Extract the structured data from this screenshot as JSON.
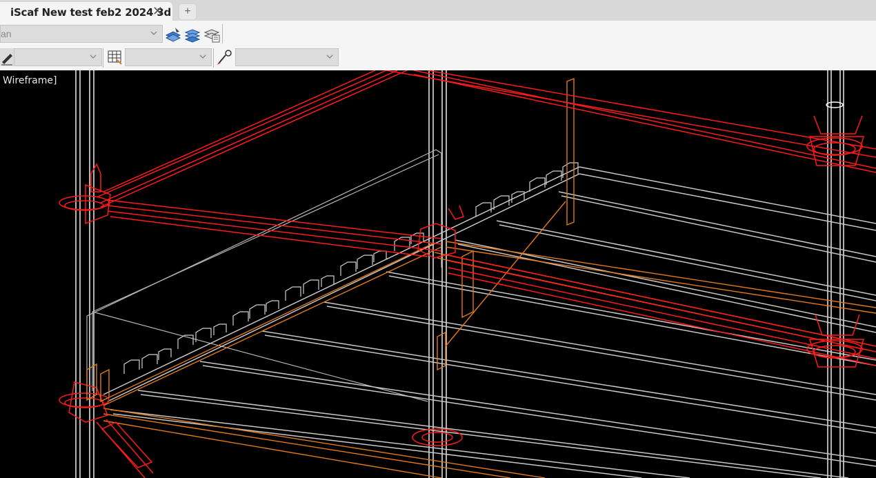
{
  "tab": {
    "title": "iScaf New test feb2 2024 3d",
    "close_glyph": "✕",
    "add_glyph": "+"
  },
  "ribbon": {
    "row1": {
      "view_combo_value": "an",
      "icons": [
        "layers-stack-icon",
        "layers-edit-icon",
        "layer-properties-icon"
      ]
    },
    "row2": {
      "icons": [
        "pencil-ruler-icon",
        "table-icon",
        "brush-icon"
      ]
    }
  },
  "viewport": {
    "style_label": "Wireframe]"
  },
  "colors": {
    "background": "#000000",
    "standards": "#ffffff",
    "ledgers": "#ff1a1a",
    "deck": "#c8c8c8",
    "toeboard": "#e07a1a"
  }
}
